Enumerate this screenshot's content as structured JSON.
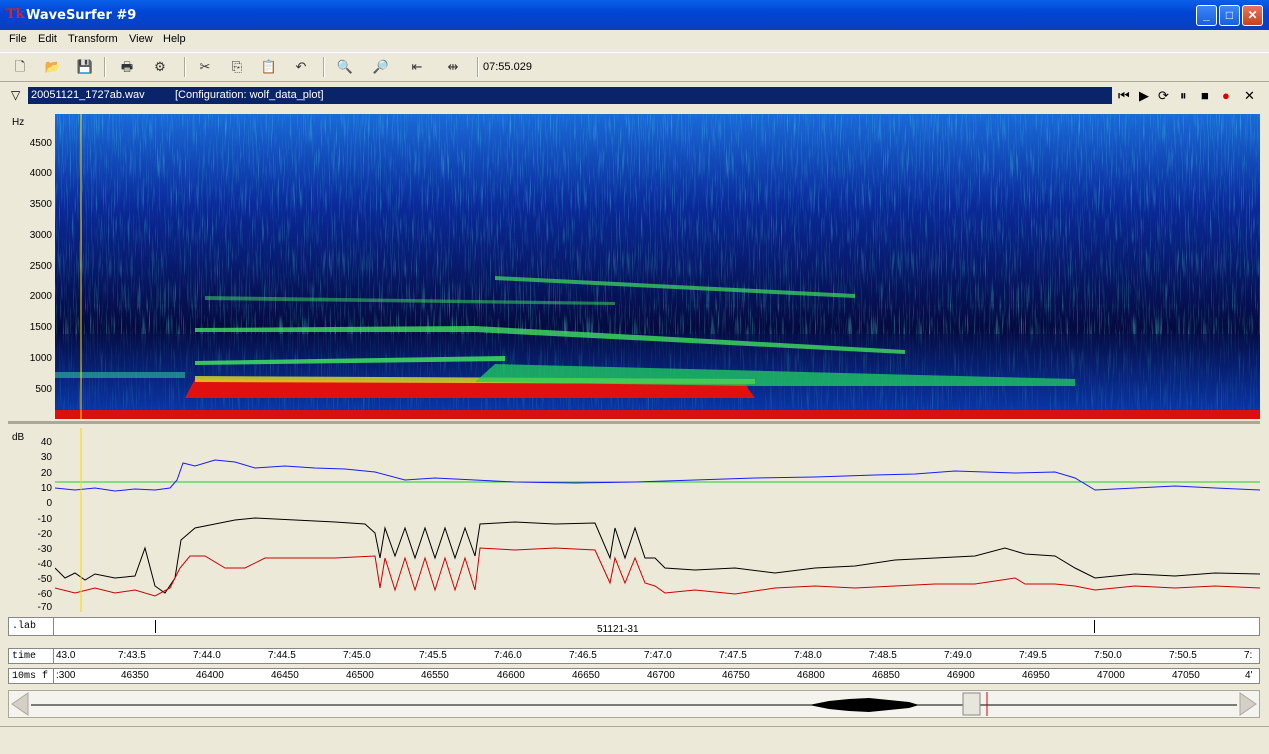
{
  "window": {
    "title": "WaveSurfer #9",
    "app_icon": "tk-feather-icon"
  },
  "menu": [
    "File",
    "Edit",
    "Transform",
    "View",
    "Help"
  ],
  "toolbar": {
    "time_readout": "07:55.029"
  },
  "sound": {
    "file_name": "20051121_1727ab.wav",
    "configuration": "[Configuration: wolf_data_plot]"
  },
  "spectrogram": {
    "unit": "Hz",
    "ticks": [
      "4500",
      "4000",
      "3500",
      "3000",
      "2500",
      "2000",
      "1500",
      "1000",
      "500"
    ]
  },
  "dbplot": {
    "unit": "dB",
    "ticks": [
      "40",
      "30",
      "20",
      "10",
      "0",
      "-10",
      "-20",
      "-30",
      "-40",
      "-50",
      "-60",
      "-70"
    ]
  },
  "label_pane": {
    "row_label": ".lab",
    "segment_label": "51121-31"
  },
  "time_ruler": {
    "row_label": "time",
    "ticks": [
      "43.0",
      "7:43.5",
      "7:44.0",
      "7:44.5",
      "7:45.0",
      "7:45.5",
      "7:46.0",
      "7:46.5",
      "7:47.0",
      "7:47.5",
      "7:48.0",
      "7:48.5",
      "7:49.0",
      "7:49.5",
      "7:50.0",
      "7:50.5",
      "7:"
    ]
  },
  "frame_ruler": {
    "row_label": "10ms f",
    "ticks": [
      ":300",
      "46350",
      "46400",
      "46450",
      "46500",
      "46550",
      "46600",
      "46650",
      "46700",
      "46750",
      "46800",
      "46850",
      "46900",
      "46950",
      "47000",
      "47050",
      "4'"
    ]
  },
  "colors": {
    "blue_line": "#1a1aff",
    "black_line": "#000000",
    "red_line": "#cc0000",
    "green_line": "#22cc22",
    "cursor": "#ffd700",
    "title_blue": "#0a246a"
  }
}
